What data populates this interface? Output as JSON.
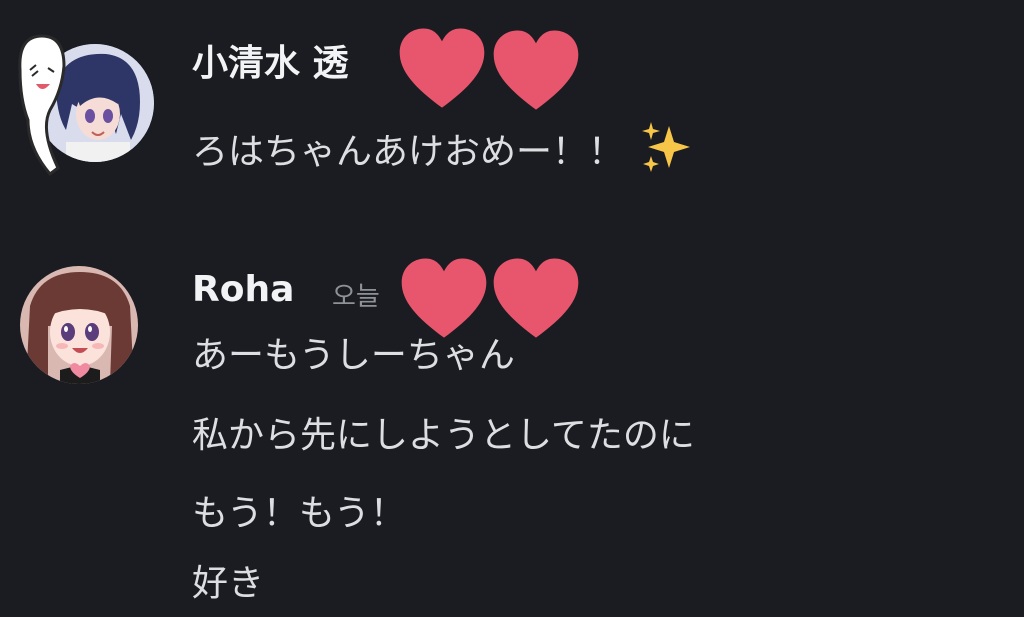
{
  "messages": [
    {
      "author": "小清水 透",
      "avatar_icon": "ghost-girl-avatar",
      "lines": [
        "ろはちゃんあけおめー！！"
      ],
      "emoji": "sparkles-icon"
    },
    {
      "author": "Roha",
      "timestamp": "오늘",
      "avatar_icon": "roha-avatar",
      "lines": [
        "あーもうしーちゃん",
        "私から先にしようとしてたのに",
        "もう！もう！",
        "好き"
      ]
    }
  ],
  "overlay_stickers": [
    "heart-icon",
    "heart-icon",
    "heart-icon",
    "heart-icon"
  ],
  "colors": {
    "background": "#1b1c21",
    "username": "#f2f3f5",
    "message": "#dcdee1",
    "timestamp": "#8e9297",
    "heart": "#e8566e",
    "sparkle": "#f7c648"
  }
}
